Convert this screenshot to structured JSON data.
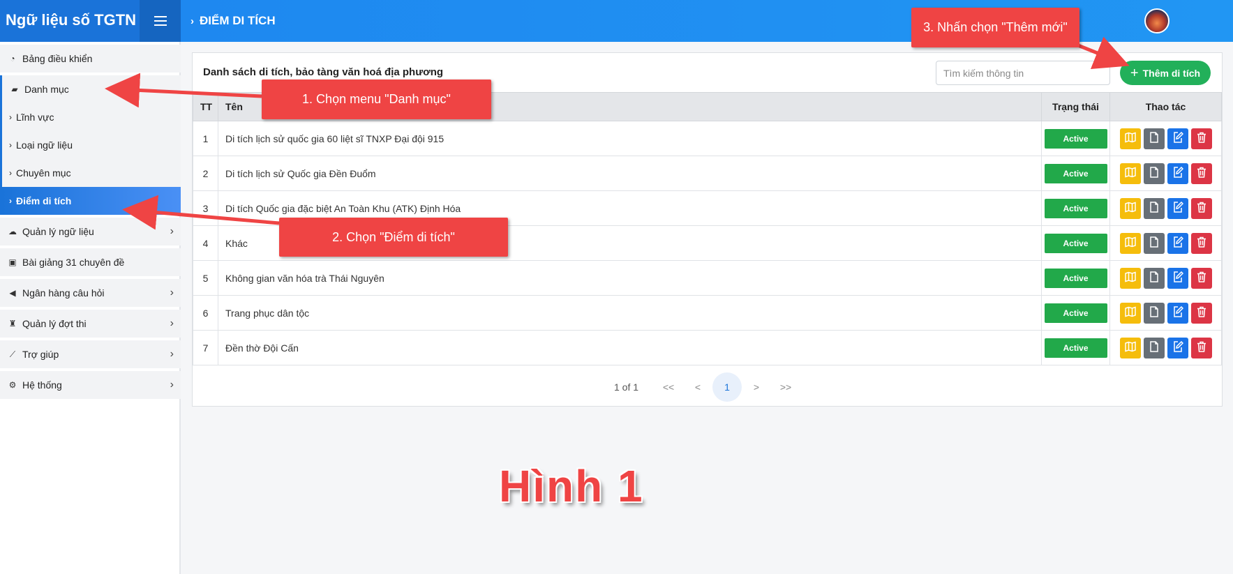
{
  "app": {
    "brand": "Ngữ liệu số TGTN",
    "breadcrumb": "ĐIỂM DI TÍCH"
  },
  "sidebar": {
    "items": [
      {
        "label": "Bảng điều khiển",
        "icon": "gauge-icon"
      },
      {
        "label": "Danh mục",
        "icon": "folder-open-icon"
      },
      {
        "label": "Lĩnh vực",
        "icon": "chevron-right-icon"
      },
      {
        "label": "Loại ngữ liệu",
        "icon": "chevron-right-icon"
      },
      {
        "label": "Chuyên mục",
        "icon": "chevron-right-icon"
      },
      {
        "label": "Điểm di tích",
        "icon": "chevron-right-icon"
      },
      {
        "label": "Quản lý ngữ liệu",
        "icon": "cloud-icon"
      },
      {
        "label": "Bài giảng 31 chuyên đề",
        "icon": "archive-icon"
      },
      {
        "label": "Ngân hàng câu hỏi",
        "icon": "megaphone-icon"
      },
      {
        "label": "Quản lý đợt thi",
        "icon": "trophy-icon"
      },
      {
        "label": "Trợ giúp",
        "icon": "chart-line-icon"
      },
      {
        "label": "Hệ thống",
        "icon": "gears-icon"
      }
    ]
  },
  "main": {
    "card_title": "Danh sách di tích, bảo tàng văn hoá địa phương",
    "search_placeholder": "Tìm kiếm thông tin",
    "add_button": "Thêm di tích",
    "columns": [
      "TT",
      "Tên",
      "Trạng thái",
      "Thao tác"
    ],
    "rows": [
      {
        "tt": "1",
        "name": "Di tích lịch sử quốc gia 60 liệt sĩ TNXP Đại đội 915",
        "status": "Active"
      },
      {
        "tt": "2",
        "name": "Di tích lịch sử Quốc gia Đền Đuổm",
        "status": "Active"
      },
      {
        "tt": "3",
        "name": "Di tích Quốc gia đặc biệt An Toàn Khu (ATK) Định Hóa",
        "status": "Active"
      },
      {
        "tt": "4",
        "name": "Khác",
        "status": "Active"
      },
      {
        "tt": "5",
        "name": "Không gian văn hóa trà Thái Nguyên",
        "status": "Active"
      },
      {
        "tt": "6",
        "name": "Trang phục dân tộc",
        "status": "Active"
      },
      {
        "tt": "7",
        "name": "Đền thờ Đội Cấn",
        "status": "Active"
      }
    ],
    "pagination": {
      "info": "1 of 1",
      "first": "<<",
      "prev": "<",
      "current": "1",
      "next": ">",
      "last": ">>"
    }
  },
  "annotations": {
    "step1": "1. Chọn menu \"Danh mục\"",
    "step2": "2. Chọn \"Điểm di tích\"",
    "step3": "3. Nhấn chọn \"Thêm mới\"",
    "figure": "Hình 1"
  },
  "colors": {
    "brand": "#1a73d9",
    "topbar": "#2196f3",
    "add_button": "#22b05a",
    "status_active": "#22a94a",
    "action_map": "#f5bd0c",
    "action_doc": "#676f77",
    "action_edit": "#1a73e8",
    "action_delete": "#dc3545",
    "annotation": "#ef4444"
  }
}
